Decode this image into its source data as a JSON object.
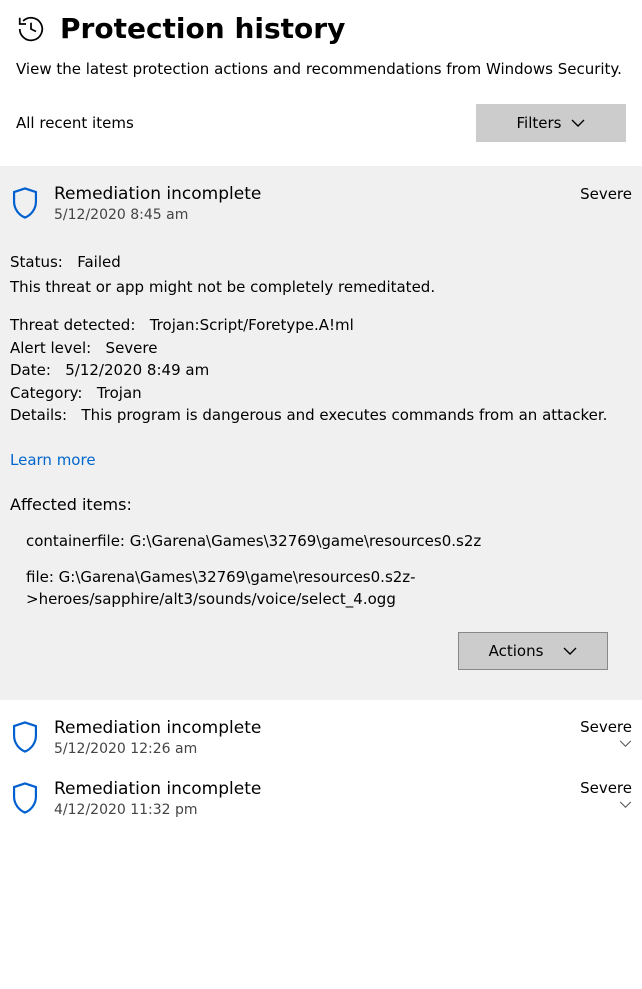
{
  "header": {
    "title": "Protection history",
    "subtitle": "View the latest protection actions and recommendations from Windows Security."
  },
  "toolbar": {
    "label": "All recent items",
    "filters_label": "Filters"
  },
  "expanded": {
    "title": "Remediation incomplete",
    "timestamp": "5/12/2020 8:45 am",
    "severity": "Severe",
    "status_label": "Status:",
    "status_value": "Failed",
    "status_desc": "This threat or app might not be completely remeditated.",
    "threat_label": "Threat detected:",
    "threat_value": "Trojan:Script/Foretype.A!ml",
    "alert_label": "Alert level:",
    "alert_value": "Severe",
    "date_label": "Date:",
    "date_value": "5/12/2020 8:49 am",
    "category_label": "Category:",
    "category_value": "Trojan",
    "details_label": "Details:",
    "details_value": "This program is dangerous and executes commands from an attacker.",
    "learn_more": "Learn more",
    "affected_header": "Affected items:",
    "affected_items": [
      "containerfile: G:\\Garena\\Games\\32769\\game\\resources0.s2z",
      "file: G:\\Garena\\Games\\32769\\game\\resources0.s2z->heroes/sapphire/alt3/sounds/voice/select_4.ogg"
    ],
    "actions_label": "Actions"
  },
  "collapsed": [
    {
      "title": "Remediation incomplete",
      "timestamp": "5/12/2020 12:26 am",
      "severity": "Severe"
    },
    {
      "title": "Remediation incomplete",
      "timestamp": "4/12/2020 11:32 pm",
      "severity": "Severe"
    }
  ]
}
